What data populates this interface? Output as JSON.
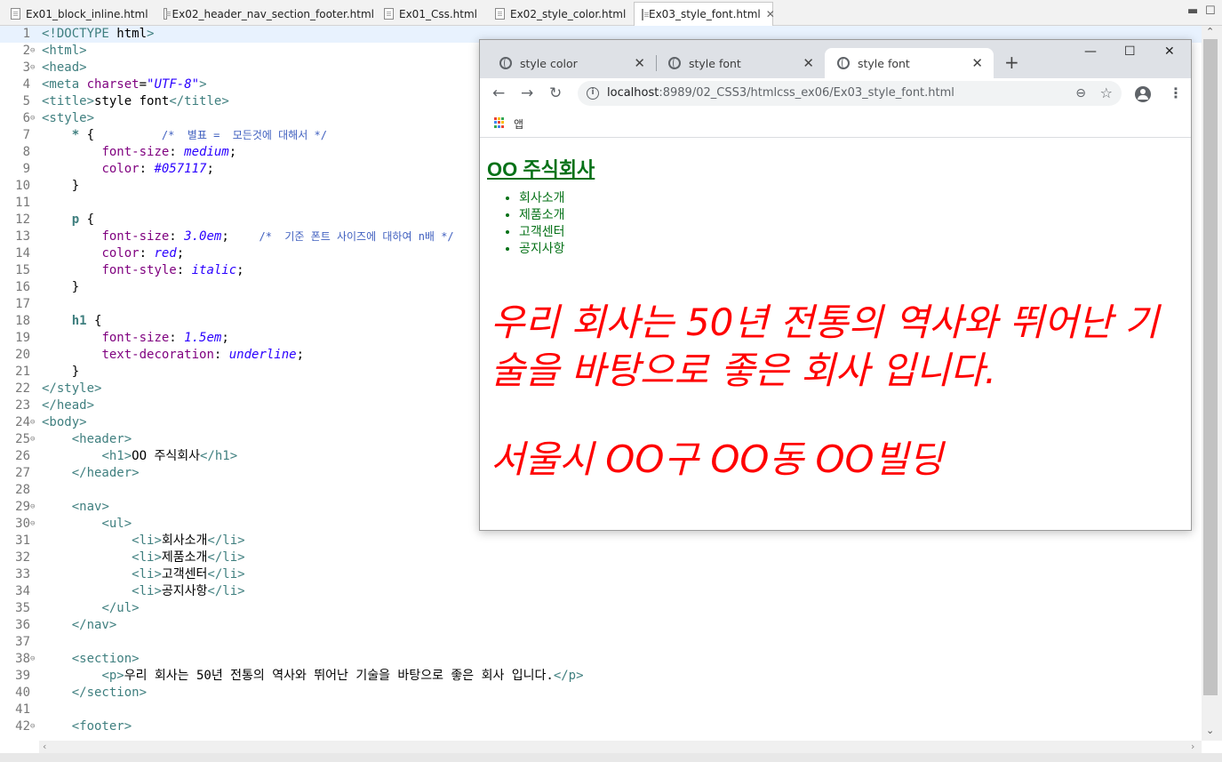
{
  "editor_tabs": [
    {
      "label": "Ex01_block_inline.html"
    },
    {
      "label": "Ex02_header_nav_section_footer.html"
    },
    {
      "label": "Ex01_Css.html"
    },
    {
      "label": "Ex02_style_color.html"
    },
    {
      "label": "Ex03_style_font.html"
    }
  ],
  "code_lines": [
    {
      "n": "1",
      "text": "<!DOCTYPE html>"
    },
    {
      "n": "2",
      "text": "<html>"
    },
    {
      "n": "3",
      "text": "<head>"
    },
    {
      "n": "4",
      "text": "<meta charset=\"UTF-8\">"
    },
    {
      "n": "5",
      "text": "<title>style font</title>"
    },
    {
      "n": "6",
      "text": "<style>"
    },
    {
      "n": "7",
      "text": "    * {         /*  별표 =  모든것에 대해서 */"
    },
    {
      "n": "8",
      "text": "        font-size: medium;"
    },
    {
      "n": "9",
      "text": "        color: #057117;"
    },
    {
      "n": "10",
      "text": "    }"
    },
    {
      "n": "11",
      "text": ""
    },
    {
      "n": "12",
      "text": "    p {"
    },
    {
      "n": "13",
      "text": "        font-size: 3.0em;    /*  기준 폰트 사이즈에 대하여 n배 */"
    },
    {
      "n": "14",
      "text": "        color: red;"
    },
    {
      "n": "15",
      "text": "        font-style: italic;"
    },
    {
      "n": "16",
      "text": "    }"
    },
    {
      "n": "17",
      "text": ""
    },
    {
      "n": "18",
      "text": "    h1 {"
    },
    {
      "n": "19",
      "text": "        font-size: 1.5em;"
    },
    {
      "n": "20",
      "text": "        text-decoration: underline;"
    },
    {
      "n": "21",
      "text": "    }"
    },
    {
      "n": "22",
      "text": "</style>"
    },
    {
      "n": "23",
      "text": "</head>"
    },
    {
      "n": "24",
      "text": "<body>"
    },
    {
      "n": "25",
      "text": "    <header>"
    },
    {
      "n": "26",
      "text": "        <h1>OO 주식회사</h1>"
    },
    {
      "n": "27",
      "text": "    </header>"
    },
    {
      "n": "28",
      "text": ""
    },
    {
      "n": "29",
      "text": "    <nav>"
    },
    {
      "n": "30",
      "text": "        <ul>"
    },
    {
      "n": "31",
      "text": "            <li>회사소개</li>"
    },
    {
      "n": "32",
      "text": "            <li>제품소개</li>"
    },
    {
      "n": "33",
      "text": "            <li>고객센터</li>"
    },
    {
      "n": "34",
      "text": "            <li>공지사항</li>"
    },
    {
      "n": "35",
      "text": "        </ul>"
    },
    {
      "n": "36",
      "text": "    </nav>"
    },
    {
      "n": "37",
      "text": ""
    },
    {
      "n": "38",
      "text": "    <section>"
    },
    {
      "n": "39",
      "text": "        <p>우리 회사는 50년 전통의 역사와 뛰어난 기술을 바탕으로 좋은 회사 입니다.</p>"
    },
    {
      "n": "40",
      "text": "    </section>"
    },
    {
      "n": "41",
      "text": ""
    },
    {
      "n": "42",
      "text": "    <footer>"
    }
  ],
  "fold_lines": [
    "2",
    "3",
    "6",
    "24",
    "25",
    "29",
    "30",
    "38",
    "42"
  ],
  "browser": {
    "tabs": [
      {
        "label": "style color"
      },
      {
        "label": "style font"
      },
      {
        "label": "style font"
      }
    ],
    "url_host": "localhost",
    "url_path": ":8989/02_CSS3/htmlcss_ex06/Ex03_style_font.html",
    "bookmark_apps_label": "앱",
    "page": {
      "h1": "OO 주식회사",
      "nav_items": [
        "회사소개",
        "제품소개",
        "고객센터",
        "공지사항"
      ],
      "section_p": "우리 회사는 50년 전통의 역사와 뛰어난 기술을 바탕으로 좋은 회사 입니다.",
      "footer_p": "서울시 OO구 OO동 OO빌딩"
    }
  },
  "colors": {
    "page_text": "#057117",
    "paragraph": "#ff0000",
    "editor_tag": "#3f7f7f",
    "editor_attr": "#7f007f",
    "editor_value": "#2a00ff",
    "editor_comment": "#3f5fbf"
  }
}
